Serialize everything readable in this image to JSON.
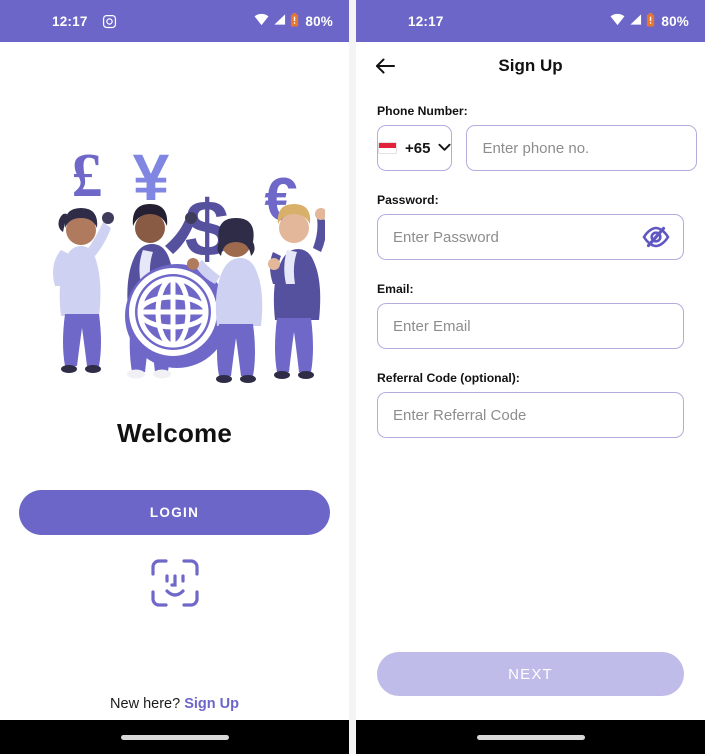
{
  "theme": {
    "primary": "#6c66c8",
    "primary_disabled": "#c0bcea",
    "border": "#b2addc",
    "text": "#111111",
    "placeholder": "#8d8d8d",
    "battery": "#e8762c"
  },
  "left_screen": {
    "status_bar": {
      "time": "12:17",
      "app_icon": "instagram-icon",
      "wifi_icon": "wifi-icon",
      "signal_icon": "cellular-signal-icon",
      "battery_icon": "battery-icon",
      "battery_text": "80%"
    },
    "illustration": {
      "name": "global-currency-illustration",
      "currency_symbols": [
        "£",
        "¥",
        "$",
        "€"
      ],
      "globe": "globe-icon",
      "people_count": 4
    },
    "title": "Welcome",
    "login_button": "LOGIN",
    "face_id_icon": "face-id-icon",
    "footer": {
      "prompt": "New here?",
      "link": "Sign Up"
    }
  },
  "right_screen": {
    "status_bar": {
      "time": "12:17",
      "wifi_icon": "wifi-icon",
      "signal_icon": "cellular-signal-icon",
      "battery_icon": "battery-icon",
      "battery_text": "80%"
    },
    "app_bar": {
      "back_icon": "arrow-left-icon",
      "title": "Sign Up"
    },
    "fields": {
      "phone": {
        "label": "Phone Number:",
        "country_flag": "singapore-flag-icon",
        "country_code": "+65",
        "chevron_icon": "chevron-down-icon",
        "value": "",
        "placeholder": "Enter phone no."
      },
      "password": {
        "label": "Password:",
        "value": "",
        "placeholder": "Enter Password",
        "toggle_icon": "eye-off-icon"
      },
      "email": {
        "label": "Email:",
        "value": "",
        "placeholder": "Enter Email"
      },
      "referral": {
        "label": "Referral Code (optional):",
        "value": "",
        "placeholder": "Enter Referral Code"
      }
    },
    "next_button": "NEXT"
  }
}
